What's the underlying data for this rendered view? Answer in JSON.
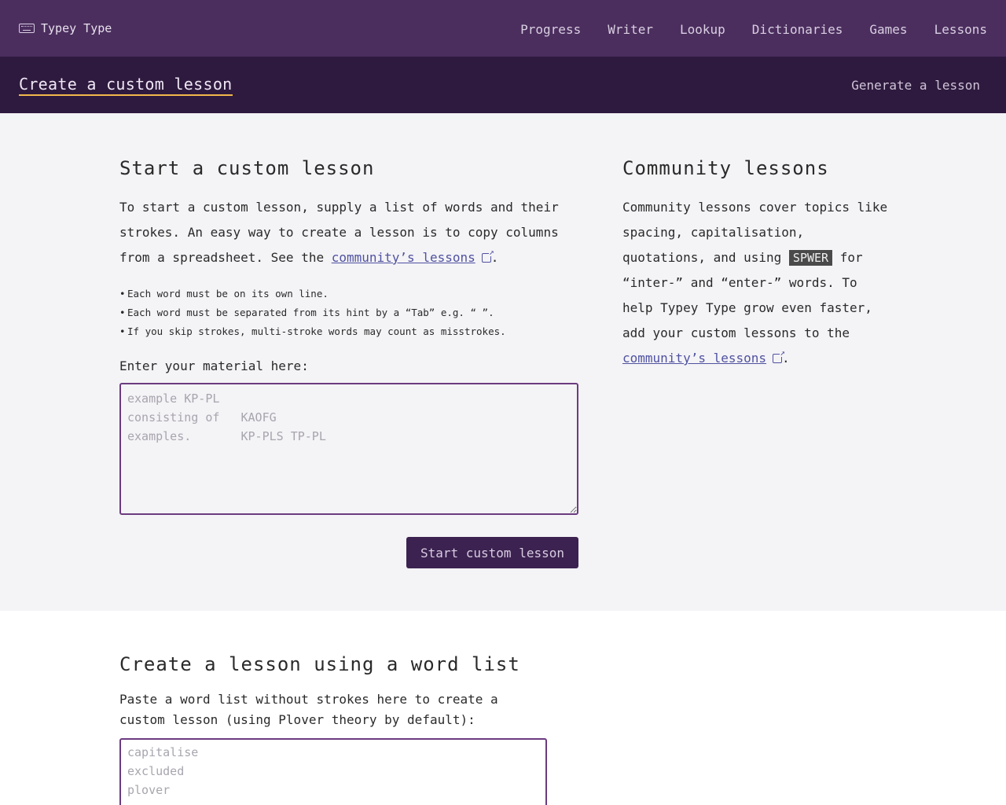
{
  "header": {
    "brand": "Typey Type",
    "nav": [
      "Progress",
      "Writer",
      "Lookup",
      "Dictionaries",
      "Games",
      "Lessons"
    ]
  },
  "subnav": {
    "current": "Create a custom lesson",
    "generate": "Generate a lesson"
  },
  "start": {
    "heading": "Start a custom lesson",
    "intro_text": "To start a custom lesson, supply a list of words and their strokes. An easy way to create a lesson is to copy columns from a spreadsheet. See the ",
    "intro_link": "community’s lessons",
    "intro_end": ".",
    "rules": [
      "Each word must be on its own line.",
      "Each word must be separated from its hint by a “Tab” e.g. “     ”.",
      "If you skip strokes, multi-stroke words may count as misstrokes."
    ],
    "material_label": "Enter your material here:",
    "material_placeholder": "example KP-PL\nconsisting of   KAOFG\nexamples.       KP-PLS TP-PL",
    "button": "Start custom lesson"
  },
  "community": {
    "heading": "Community lessons",
    "text1": "Community lessons cover topics like spacing, capitalisation, quotations, and using ",
    "kbd": "SPWER",
    "text2": " for “inter-” and “enter-” words. To help Typey Type grow even faster, add your custom lessons to the ",
    "link": "community’s lessons",
    "end": "."
  },
  "wordlist": {
    "heading": "Create a lesson using a word list",
    "text": "Paste a word list without strokes here to create a custom lesson (using Plover theory by default):",
    "placeholder": "capitalise\nexcluded\nplover"
  },
  "colors": {
    "header_bg": "#4b2e5e",
    "subnav_bg": "#2f1a3f",
    "accent_underline": "#f2b84b",
    "link": "#4f52a0",
    "button_bg": "#3c2250"
  },
  "icons": {
    "brand": "keyboard-icon",
    "external": "external-link-icon"
  }
}
